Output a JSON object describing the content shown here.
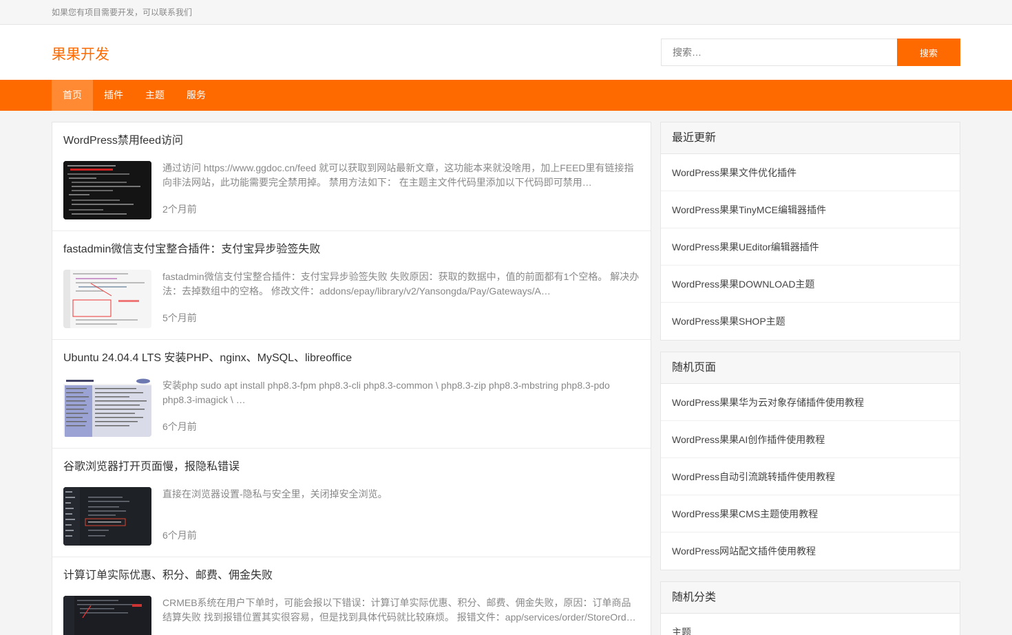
{
  "topbar": {
    "notice": "如果您有项目需要开发，可以联系我们"
  },
  "header": {
    "logo": "果果开发"
  },
  "search": {
    "placeholder": "搜索…",
    "button": "搜索"
  },
  "nav": [
    {
      "label": "首页"
    },
    {
      "label": "插件"
    },
    {
      "label": "主题"
    },
    {
      "label": "服务"
    }
  ],
  "posts": [
    {
      "title": "WordPress禁用feed访问",
      "excerpt": "通过访问 https://www.ggdoc.cn/feed 就可以获取到网站最新文章，这功能本来就没啥用，加上FEED里有链接指向非法网站，此功能需要完全禁用掉。 禁用方法如下： 在主题主文件代码里添加以下代码即可禁用 add_action…",
      "date": "2个月前"
    },
    {
      "title": "fastadmin微信支付宝整合插件：支付宝异步验签失败",
      "excerpt": "fastadmin微信支付宝整合插件：支付宝异步验签失败 失败原因：获取的数据中，值的前面都有1个空格。 解决办法：去掉数组中的空格。 修改文件：addons/epay/library/v2/Yansongda/Pay/Gateways/A…",
      "date": "5个月前"
    },
    {
      "title": "Ubuntu 24.04.4 LTS 安装PHP、nginx、MySQL、libreoffice",
      "excerpt": "安装php sudo apt install php8.3-fpm php8.3-cli php8.3-common \\      php8.3-zip php8.3-mbstring php8.3-pdo php8.3-imagick \\ …",
      "date": "6个月前"
    },
    {
      "title": "谷歌浏览器打开页面慢，报隐私错误",
      "excerpt": "直接在浏览器设置-隐私与安全里，关闭掉安全浏览。",
      "date": "6个月前"
    },
    {
      "title": "计算订单实际优惠、积分、邮费、佣金失败",
      "excerpt": "CRMEB系统在用户下单时，可能会报以下错误：计算订单实际优惠、积分、邮费、佣金失败，原因：订单商品结算失败 找到报错位置其实很容易，但是找到具体代码就比较麻烦。 报错文件：app/services/order/StoreOrd…",
      "date": ""
    }
  ],
  "widgets": [
    {
      "title": "最近更新",
      "items": [
        "WordPress果果文件优化插件",
        "WordPress果果TinyMCE编辑器插件",
        "WordPress果果UEditor编辑器插件",
        "WordPress果果DOWNLOAD主题",
        "WordPress果果SHOP主题"
      ]
    },
    {
      "title": "随机页面",
      "items": [
        "WordPress果果华为云对象存储插件使用教程",
        "WordPress果果AI创作插件使用教程",
        "WordPress自动引流跳转插件使用教程",
        "WordPress果果CMS主题使用教程",
        "WordPress网站配文插件使用教程"
      ]
    },
    {
      "title": "随机分类",
      "items": [
        "主题"
      ]
    }
  ]
}
